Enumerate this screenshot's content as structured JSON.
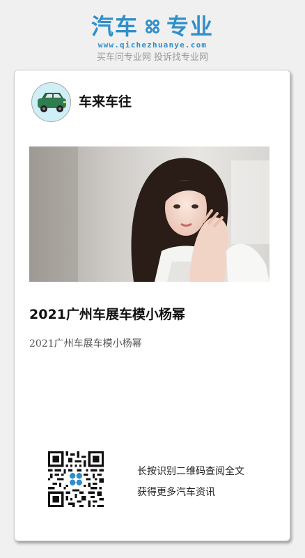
{
  "brand": {
    "logo_left": "汽车",
    "logo_right": "专业",
    "url": "www.qichezhuanye.com",
    "slogan": "买车问专业网 投诉找专业网",
    "logo_color": "#2f8fc9"
  },
  "card": {
    "author_name": "车来车往",
    "avatar_icon": "green-car-icon",
    "image_alt": "2021广州车展车模小杨幂",
    "title": "2021广州车展车模小杨幂",
    "summary": "2021广州车展车模小杨幂",
    "qr_icon": "qr-code-icon",
    "qr_hint_line1": "长按识别二维码查阅全文",
    "qr_hint_line2": "获得更多汽车资讯"
  }
}
